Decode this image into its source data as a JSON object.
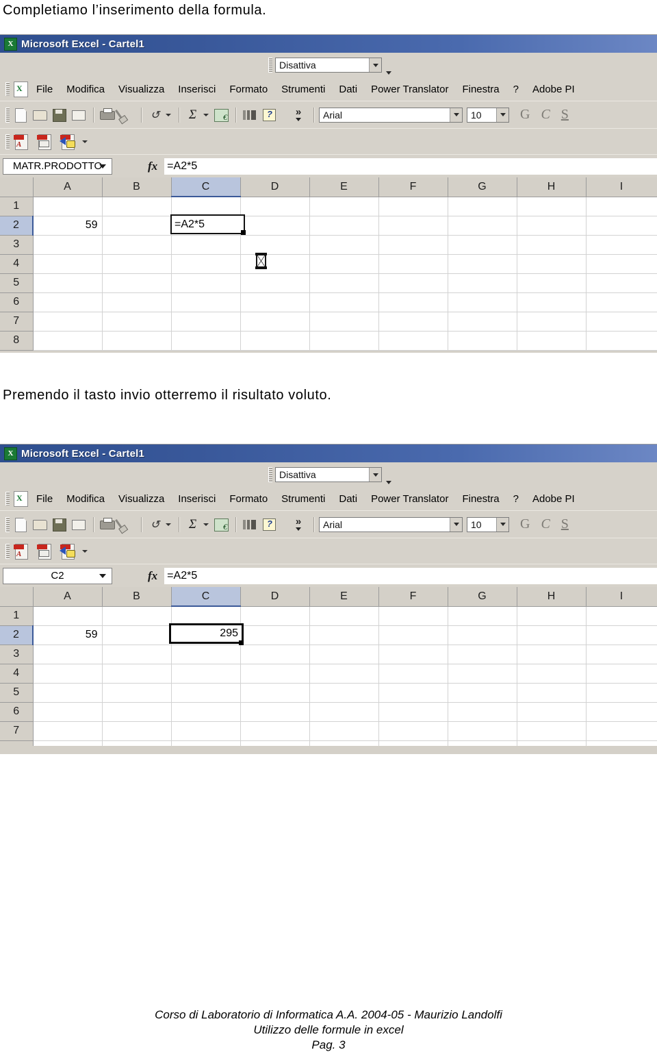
{
  "document": {
    "intro_text": "Completiamo l’inserimento della formula.",
    "middle_text": "Premendo il tasto invio otterremo il risultato voluto."
  },
  "footer": {
    "line1": "Corso di Laboratorio di Informatica A.A. 2004-05 - Maurizio Landolfi",
    "line2": "Utilizzo delle formule in excel",
    "line3": "Pag. 3"
  },
  "colors": {
    "titlebar_start": "#2e4f8f",
    "titlebar_end": "#6c87c4",
    "toolbar_bg": "#d6d2ca",
    "header_bg": "#d4d0c8",
    "header_active": "#b9c5dd",
    "gridline": "#d2d2d2",
    "cell_border": "#121212"
  },
  "screenshot1": {
    "title": "Microsoft Excel - Cartel1",
    "title_icon": "excel-icon",
    "translator": {
      "value": "Disattiva",
      "dropdown_icon": "chevron-down-icon",
      "overflow_icon": "chevron-down-icon"
    },
    "menu": [
      "File",
      "Modifica",
      "Visualizza",
      "Inserisci",
      "Formato",
      "Strumenti",
      "Dati",
      "Power Translator",
      "Finestra",
      "?",
      "Adobe PI"
    ],
    "toolbar": {
      "icons": [
        "new-document-icon",
        "open-folder-icon",
        "save-icon",
        "email-icon",
        "print-icon",
        "format-painter-icon",
        "undo-icon",
        "undo-dropdown-icon",
        "autosum-icon",
        "autosum-dropdown-icon",
        "euro-format-icon",
        "chart-wizard-icon",
        "help-icon",
        "toolbar-overflow-icon"
      ],
      "font_name": "Arial",
      "font_size": "10",
      "bold_label": "G",
      "italic_label": "C",
      "underline_label": "S"
    },
    "pdf_toolbar": {
      "icons": [
        "convert-to-pdf-icon",
        "pdf-email-icon",
        "pdf-review-icon",
        "pdf-dropdown-icon"
      ]
    },
    "formula_bar": {
      "name_box": "MATR.PRODOTTO",
      "name_box_icon": "chevron-down-icon",
      "fx_icon": "fx-icon",
      "formula": "=A2*5"
    },
    "grid": {
      "columns": [
        "A",
        "B",
        "C",
        "D",
        "E",
        "F",
        "G",
        "H",
        "I"
      ],
      "active_column": "C",
      "rows": [
        "1",
        "2",
        "3",
        "4",
        "5",
        "6",
        "7",
        "8"
      ],
      "active_row": "2",
      "cells": {
        "A2": "59",
        "C2": "=A2*5"
      },
      "editing_cell": "C2",
      "cursor_icon": "hourglass-cursor",
      "cursor_cell": "D4"
    }
  },
  "screenshot2": {
    "title": "Microsoft Excel - Cartel1",
    "title_icon": "excel-icon",
    "translator": {
      "value": "Disattiva",
      "dropdown_icon": "chevron-down-icon",
      "overflow_icon": "chevron-down-icon"
    },
    "menu": [
      "File",
      "Modifica",
      "Visualizza",
      "Inserisci",
      "Formato",
      "Strumenti",
      "Dati",
      "Power Translator",
      "Finestra",
      "?",
      "Adobe PI"
    ],
    "toolbar": {
      "icons": [
        "new-document-icon",
        "open-folder-icon",
        "save-icon",
        "email-icon",
        "print-icon",
        "format-painter-icon",
        "undo-icon",
        "undo-dropdown-icon",
        "autosum-icon",
        "autosum-dropdown-icon",
        "euro-format-icon",
        "chart-wizard-icon",
        "help-icon",
        "toolbar-overflow-icon"
      ],
      "font_name": "Arial",
      "font_size": "10",
      "bold_label": "G",
      "italic_label": "C",
      "underline_label": "S"
    },
    "pdf_toolbar": {
      "icons": [
        "convert-to-pdf-icon",
        "pdf-email-icon",
        "pdf-review-icon",
        "pdf-dropdown-icon"
      ]
    },
    "formula_bar": {
      "name_box": "C2",
      "name_box_icon": "chevron-down-icon",
      "fx_icon": "fx-icon",
      "formula": "=A2*5"
    },
    "grid": {
      "columns": [
        "A",
        "B",
        "C",
        "D",
        "E",
        "F",
        "G",
        "H",
        "I"
      ],
      "active_column": "C",
      "rows": [
        "1",
        "2",
        "3",
        "4",
        "5",
        "6",
        "7"
      ],
      "active_row": "2",
      "cells": {
        "A2": "59",
        "C2": "295"
      },
      "selected_cell": "C2"
    }
  }
}
